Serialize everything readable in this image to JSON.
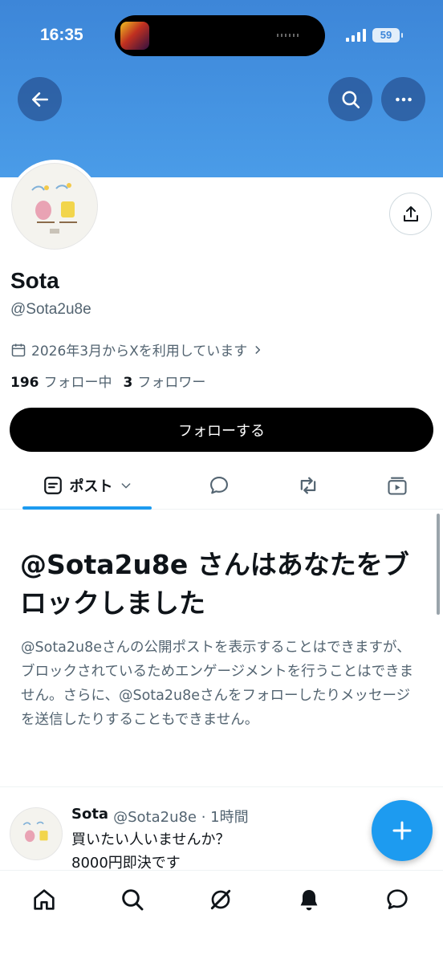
{
  "status_bar": {
    "time": "16:35",
    "battery": "59"
  },
  "profile": {
    "display_name": "Sota",
    "handle": "@Sota2u8e",
    "joined": "2026年3月からXを利用しています",
    "following_count": "196",
    "following_label": "フォロー中",
    "followers_count": "3",
    "followers_label": "フォロワー",
    "follow_button": "フォローする"
  },
  "tabs": [
    {
      "label": "ポスト",
      "icon": "post-list-icon",
      "active": true
    },
    {
      "icon": "reply-bubble-icon"
    },
    {
      "icon": "repost-icon"
    },
    {
      "icon": "video-icon"
    }
  ],
  "blocked": {
    "title": "@Sota2u8e さんはあなたをブロックしました",
    "description": "@Sota2u8eさんの公開ポストを表示することはできますが、ブロックされているためエンゲージメントを行うことはできません。さらに、@Sota2u8eさんをフォローしたりメッセージを送信したりすることもできません。"
  },
  "post": {
    "name": "Sota",
    "meta": "@Sota2u8e · 1時間",
    "lines": [
      "買いたい人いませんか？",
      "8000円即決です"
    ]
  },
  "bottom_nav": [
    "home-icon",
    "search-icon",
    "grok-icon",
    "notifications-icon",
    "messages-icon"
  ],
  "colors": {
    "banner": "#4a9ce8",
    "accent": "#1d9bf0",
    "text": "#0f1419",
    "muted": "#536471"
  }
}
